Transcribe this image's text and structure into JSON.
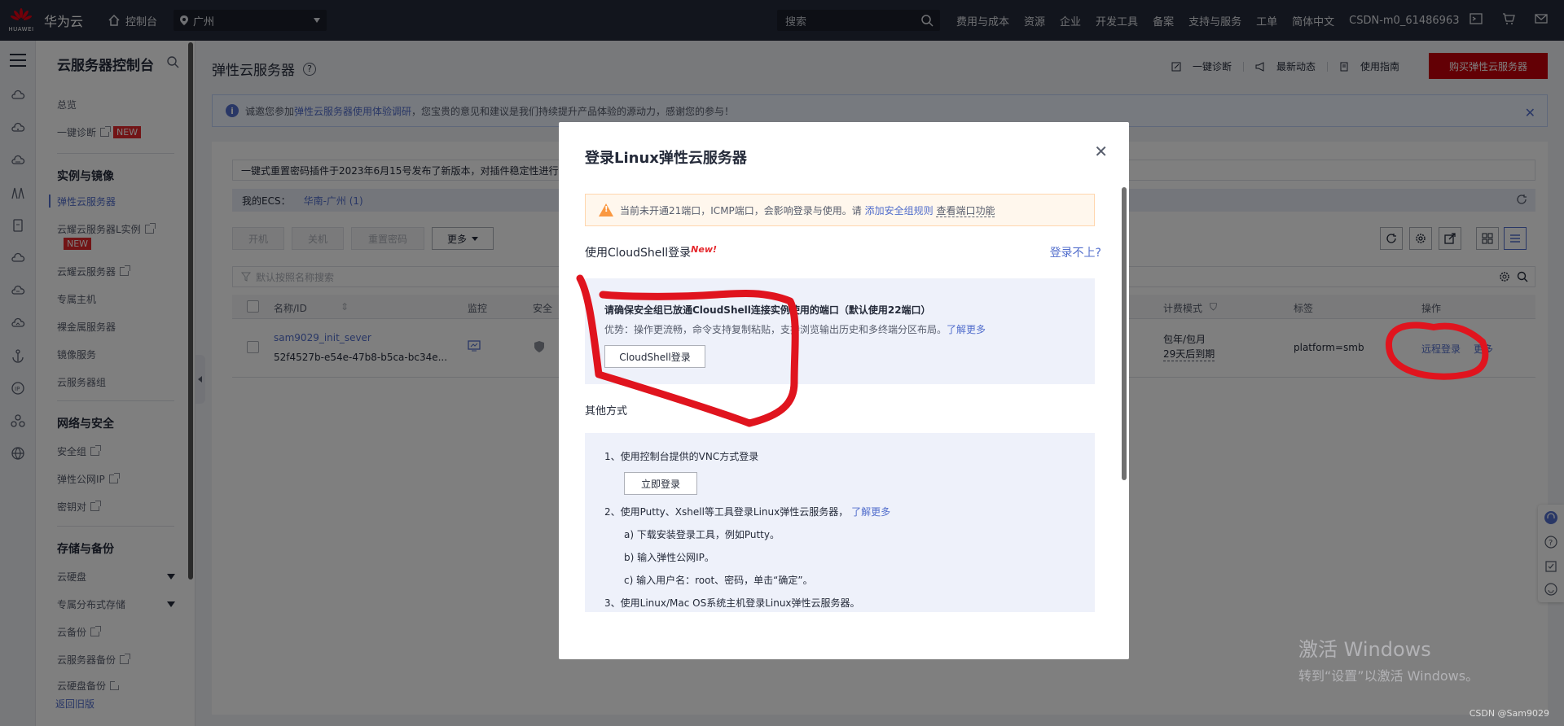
{
  "topbar": {
    "logo_text": "HUAWEI",
    "brand": "华为云",
    "console": "控制台",
    "region": "广州",
    "search_placeholder": "搜索",
    "nav": [
      "费用与成本",
      "资源",
      "企业",
      "开发工具",
      "备案",
      "支持与服务",
      "工单",
      "简体中文",
      "CSDN-m0_61486963"
    ]
  },
  "sidebar": {
    "title": "云服务器控制台",
    "overview": "总览",
    "diagnose": "一键诊断",
    "new_tag": "NEW",
    "group_instances": "实例与镜像",
    "ecs": "弹性云服务器",
    "flexus_l": "云耀云服务器L实例",
    "flexus": "云耀云服务器",
    "dedicated_host": "专属主机",
    "bare_metal": "裸金属服务器",
    "image": "镜像服务",
    "server_group": "云服务器组",
    "group_network": "网络与安全",
    "security_group": "安全组",
    "eip": "弹性公网IP",
    "keypair": "密钥对",
    "group_storage": "存储与备份",
    "evs": "云硬盘",
    "dss": "专属分布式存储",
    "cbr": "云备份",
    "server_backup": "云服务器备份",
    "disk_backup": "云硬盘备份",
    "footer": "返回旧版"
  },
  "main": {
    "title": "弹性云服务器",
    "help": "?",
    "actions": [
      "一键诊断",
      "最新动态",
      "使用指南"
    ],
    "buy": "购买弹性云服务器",
    "notice_prefix": "诚邀您参加",
    "notice_link": "弹性云服务器使用体验调研",
    "notice_suffix": "，您宝贵的意见和建议是我们持续提升产品体验的源动力，感谢您的参与！",
    "pwd_notice": "一键式重置密码插件于2023年6月15号发布了新版本，对插件稳定性进行了",
    "my_ecs": "我的ECS：",
    "region_count": "华南-广州 (1)",
    "btn_start": "开机",
    "btn_stop": "关机",
    "btn_reset": "重置密码",
    "btn_more": "更多",
    "filter_placeholder": "默认按照名称搜索",
    "columns": {
      "name": "名称/ID",
      "monitor": "监控",
      "security": "安全",
      "billing": "计费模式",
      "tags": "标签",
      "ops": "操作"
    },
    "row": {
      "name": "sam9029_init_sever",
      "id": "52f4527b-e54e-47b8-b5ca-bc34e...",
      "billing_line1": "包年/包月",
      "billing_line2": "29天后到期",
      "tag": "platform=smb",
      "remote_login": "远程登录",
      "more": "更多"
    }
  },
  "modal": {
    "title": "登录Linux弹性云服务器",
    "warn_text": "当前未开通21端口，ICMP端口，会影响登录与使用。请",
    "warn_link": "添加安全组规则",
    "warn_link2": "查看端口功能",
    "cloudshell_title": "使用CloudShell登录",
    "new_badge": "New!",
    "cant_login": "登录不上?",
    "cs_box_title": "请确保安全组已放通CloudShell连接实例使用的端口（默认使用22端口）",
    "cs_box_desc": "优势：操作更流畅，命令支持复制粘贴，支持浏览输出历史和多终端分区布局。",
    "learn_more": "了解更多",
    "cs_button": "CloudShell登录",
    "other_title": "其他方式",
    "m1": "1、使用控制台提供的VNC方式登录",
    "login_now": "立即登录",
    "m2": "2、使用Putty、Xshell等工具登录Linux弹性云服务器，",
    "m2a": "a) 下载安装登录工具，例如Putty。",
    "m2b": "b) 输入弹性公网IP。",
    "m2c": "c) 输入用户名：root、密码，单击“确定”。",
    "m3": "3、使用Linux/Mac OS系统主机登录Linux弹性云服务器。"
  },
  "watermark": {
    "line1": "激活 Windows",
    "line2": "转到“设置”以激活 Windows。"
  },
  "csdn_credit": "CSDN @Sam9029",
  "colors": {
    "topbar": "#252b3a",
    "primary": "#526ecc",
    "buy": "#c7000b",
    "annotation": "#e0141e"
  }
}
